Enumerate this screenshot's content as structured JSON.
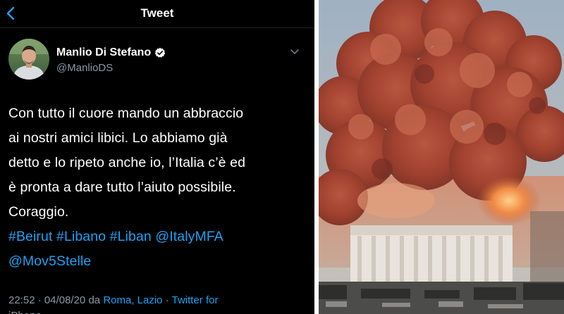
{
  "topbar": {
    "title": "Tweet"
  },
  "tweet": {
    "author_name": "Manlio Di Stefano",
    "author_handle": "@ManlioDS",
    "lines": [
      "Con tutto il cuore mando un abbraccio",
      "ai nostri amici libici. Lo abbiamo già",
      "detto e lo ripeto anche io, l’Italia c’è ed",
      "è pronta a dare tutto l’aiuto possibile.",
      "Coraggio."
    ],
    "tags": [
      "#Beirut",
      "#Libano",
      "#Liban",
      "@ItalyMFA",
      "@Mov5Stelle"
    ],
    "meta": {
      "time": "22:52",
      "separator": "·",
      "date": "04/08/20",
      "da": "da",
      "location": "Roma, Lazio",
      "client": "Twitter for",
      "client_cut": "iPhone"
    }
  },
  "colors": {
    "background": "#000000",
    "text": "#ffffff",
    "link": "#1da1f2",
    "muted": "#8b98a5"
  },
  "icons": [
    "back-arrow-icon",
    "verified-badge-icon",
    "chevron-down-icon"
  ]
}
